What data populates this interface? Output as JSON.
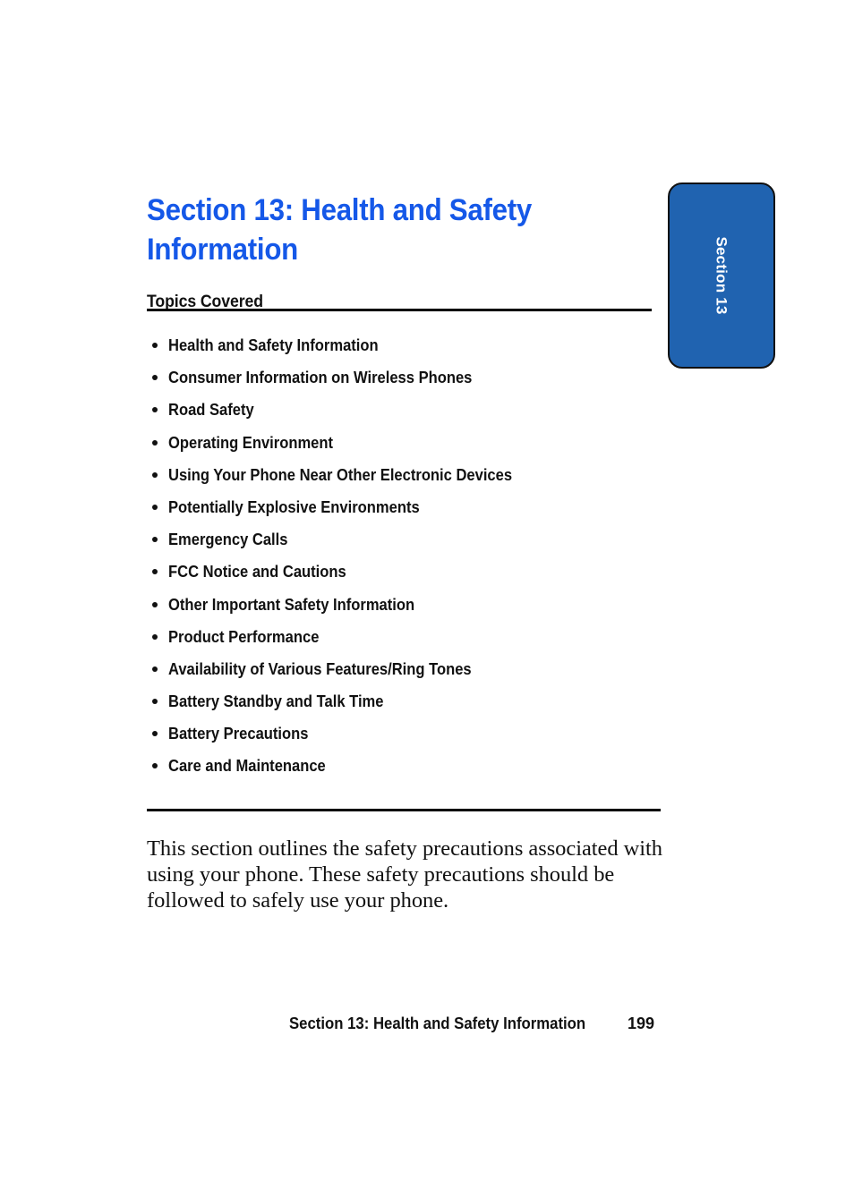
{
  "document": {
    "type": "user-manual-page",
    "title": "Section 13: Health and Safety Information"
  },
  "side_tab": {
    "label": "Section 13",
    "background_color": "#2063B0",
    "text_color": "#FFFFFF",
    "border_color": "#101010"
  },
  "heading": {
    "title": "Section 13: Health and Safety Information",
    "color": "#1558E8"
  },
  "topics": {
    "heading": "Topics Covered",
    "items": [
      {
        "label": "Health and Safety Information"
      },
      {
        "label": "Consumer Information on Wireless Phones"
      },
      {
        "label": "Road Safety"
      },
      {
        "label": "Operating Environment"
      },
      {
        "label": "Using Your Phone Near Other Electronic Devices"
      },
      {
        "label": "Potentially Explosive Environments"
      },
      {
        "label": "Emergency Calls"
      },
      {
        "label": "FCC Notice and Cautions"
      },
      {
        "label": "Other Important Safety Information"
      },
      {
        "label": "Product Performance"
      },
      {
        "label": "Availability of Various Features/Ring Tones"
      },
      {
        "label": "Battery Standby and Talk Time"
      },
      {
        "label": "Battery Precautions"
      },
      {
        "label": "Care and Maintenance"
      }
    ]
  },
  "body": {
    "paragraph": "This section outlines the safety precautions associated with using your phone. These safety precautions should be followed to safely use your phone."
  },
  "footer": {
    "title": "Section 13: Health and Safety Information",
    "page_number": "199"
  }
}
